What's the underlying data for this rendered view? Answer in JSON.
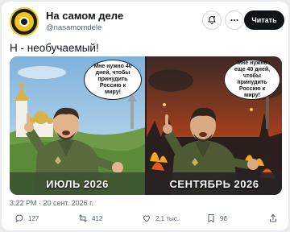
{
  "account": {
    "name": "На самом деле",
    "handle": "@nasamomdele",
    "follow_label": "Читать"
  },
  "post": {
    "text": "Н - необучаемый!"
  },
  "media": {
    "left": {
      "bubble": "Мне нужно 40 дней, чтобы принудить Россию к миру!",
      "caption": "ИЮЛЬ 2026",
      "scene": "cartoon figure in green military-style clothing shouting and pointing, city skyline with domes in background"
    },
    "right": {
      "bubble": "Мне нужно еще 40 дней, чтобы принудить Россию к миру!",
      "caption": "СЕНТЯБРЬ 2026",
      "scene": "same cartoon figure shouting, city burning in background"
    }
  },
  "meta": {
    "time": "3:22 PM",
    "date": "20 сент. 2026 г."
  },
  "actions": {
    "replies": "127",
    "reposts": "412",
    "likes": "2,1 тыс.",
    "bookmarks": "96"
  },
  "colors": {
    "accent": "#0f1419",
    "muted": "#536471",
    "left_sky": "#9fc7e6",
    "right_sky": "#c24a1e"
  },
  "icons": [
    "notification-bell-icon",
    "more-icon",
    "reply-icon",
    "repost-icon",
    "like-icon",
    "bookmark-icon",
    "share-icon"
  ]
}
